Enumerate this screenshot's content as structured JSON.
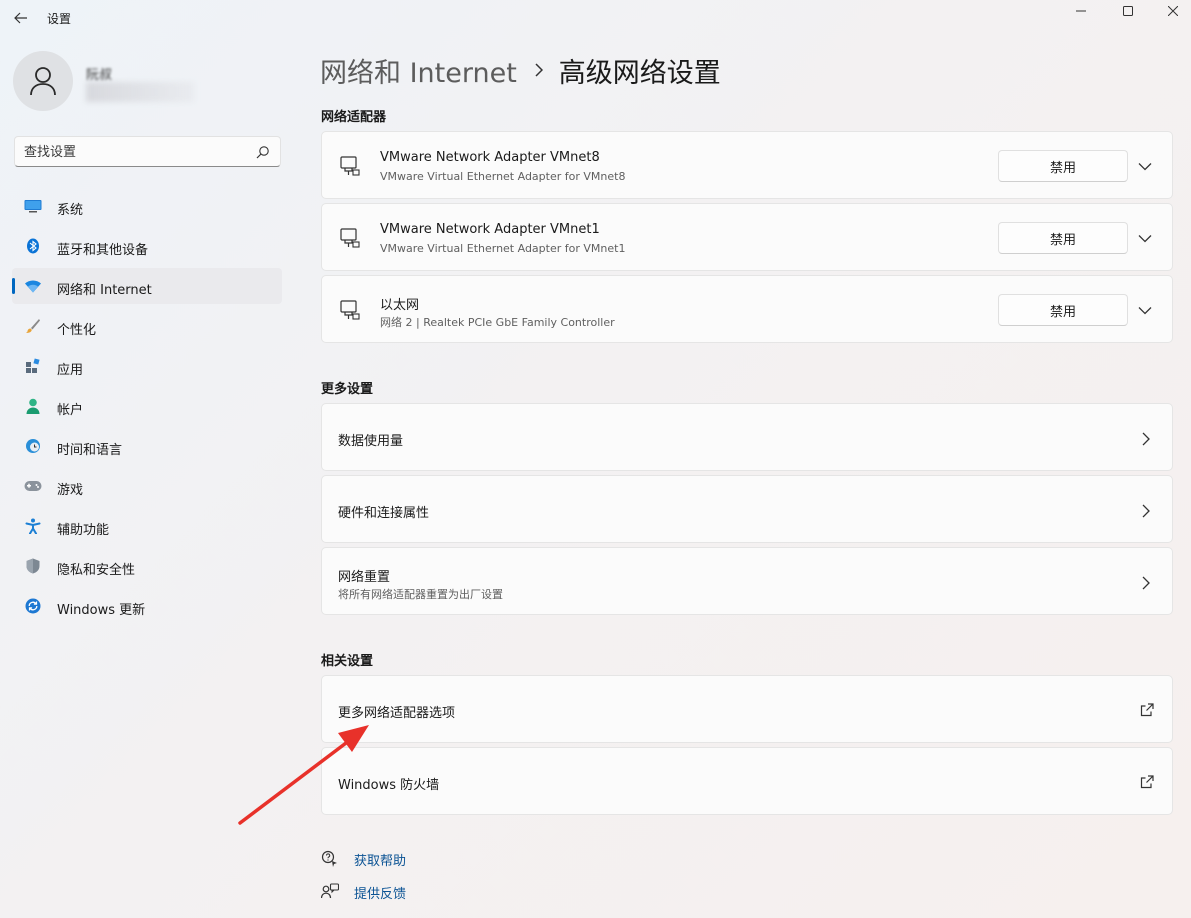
{
  "window": {
    "title": "设置"
  },
  "user": {
    "name": "阮叔"
  },
  "search": {
    "placeholder": "查找设置"
  },
  "sidebar": {
    "items": [
      {
        "label": "系统",
        "icon": "display-icon"
      },
      {
        "label": "蓝牙和其他设备",
        "icon": "bluetooth-icon"
      },
      {
        "label": "网络和 Internet",
        "icon": "wifi-icon",
        "active": true
      },
      {
        "label": "个性化",
        "icon": "brush-icon"
      },
      {
        "label": "应用",
        "icon": "apps-icon"
      },
      {
        "label": "帐户",
        "icon": "account-icon"
      },
      {
        "label": "时间和语言",
        "icon": "globe-clock-icon"
      },
      {
        "label": "游戏",
        "icon": "gamepad-icon"
      },
      {
        "label": "辅助功能",
        "icon": "accessibility-icon"
      },
      {
        "label": "隐私和安全性",
        "icon": "shield-icon"
      },
      {
        "label": "Windows 更新",
        "icon": "update-icon"
      }
    ]
  },
  "breadcrumb": {
    "parent": "网络和 Internet",
    "current": "高级网络设置"
  },
  "adapters": {
    "title": "网络适配器",
    "items": [
      {
        "name": "VMware Network Adapter VMnet8",
        "description": "VMware Virtual Ethernet Adapter for VMnet8",
        "button": "禁用"
      },
      {
        "name": "VMware Network Adapter VMnet1",
        "description": "VMware Virtual Ethernet Adapter for VMnet1",
        "button": "禁用"
      },
      {
        "name": "以太网",
        "description": "网络 2 | Realtek PCIe GbE Family Controller",
        "button": "禁用"
      }
    ]
  },
  "more_settings": {
    "title": "更多设置",
    "items": [
      {
        "label": "数据使用量"
      },
      {
        "label": "硬件和连接属性"
      },
      {
        "label": "网络重置",
        "description": "将所有网络适配器重置为出厂设置"
      }
    ]
  },
  "related_settings": {
    "title": "相关设置",
    "items": [
      {
        "label": "更多网络适配器选项"
      },
      {
        "label": "Windows 防火墙"
      }
    ]
  },
  "help": {
    "get_help": "获取帮助",
    "feedback": "提供反馈"
  },
  "colors": {
    "accent": "#0067c0",
    "annotation_arrow": "#e8312a",
    "link": "#0b5394"
  }
}
